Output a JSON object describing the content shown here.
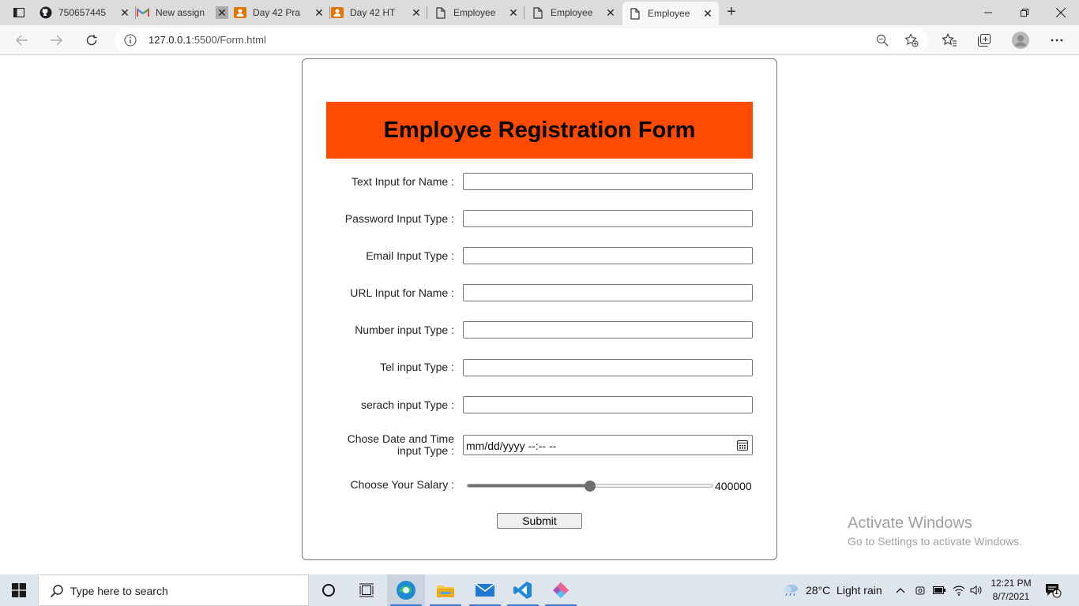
{
  "browser": {
    "tabs": [
      {
        "title": "750657445",
        "icon": "github-icon"
      },
      {
        "title": "New assign",
        "icon": "gmail-icon"
      },
      {
        "title": "Day 42 Pra",
        "icon": "contact-card-icon"
      },
      {
        "title": "Day 42 HT",
        "icon": "contact-card-icon"
      },
      {
        "title": "Employee",
        "icon": "page-icon"
      },
      {
        "title": "Employee",
        "icon": "page-icon"
      },
      {
        "title": "Employee",
        "icon": "page-icon"
      }
    ],
    "url_host": "127.0.0.1",
    "url_path": ":5500/Form.html"
  },
  "form": {
    "heading": "Employee Registration Form",
    "fields": [
      {
        "label": "Text Input for Name :",
        "type": "text",
        "value": ""
      },
      {
        "label": "Password Input Type :",
        "type": "password",
        "value": ""
      },
      {
        "label": "Email Input Type :",
        "type": "email",
        "value": ""
      },
      {
        "label": "URL Input for Name :",
        "type": "url",
        "value": ""
      },
      {
        "label": "Number input Type :",
        "type": "number",
        "value": ""
      },
      {
        "label": "Tel input Type :",
        "type": "tel",
        "value": ""
      },
      {
        "label": "serach input Type :",
        "type": "search",
        "value": ""
      }
    ],
    "datetime": {
      "label_line1": "Chose Date and Time",
      "label_line2": "input Type :",
      "placeholder": "mm/dd/yyyy --:-- --"
    },
    "salary": {
      "label": "Choose Your Salary :",
      "value_text": "400000",
      "fraction": 0.5
    },
    "submit_label": "Submit",
    "accent_color": "#ff4b00"
  },
  "watermark": {
    "line1": "Activate Windows",
    "line2": "Go to Settings to activate Windows."
  },
  "taskbar": {
    "search_placeholder": "Type here to search",
    "weather": "28°C  Light rain",
    "time": "12:21 PM",
    "date": "8/7/2021",
    "notification_count": "1"
  }
}
